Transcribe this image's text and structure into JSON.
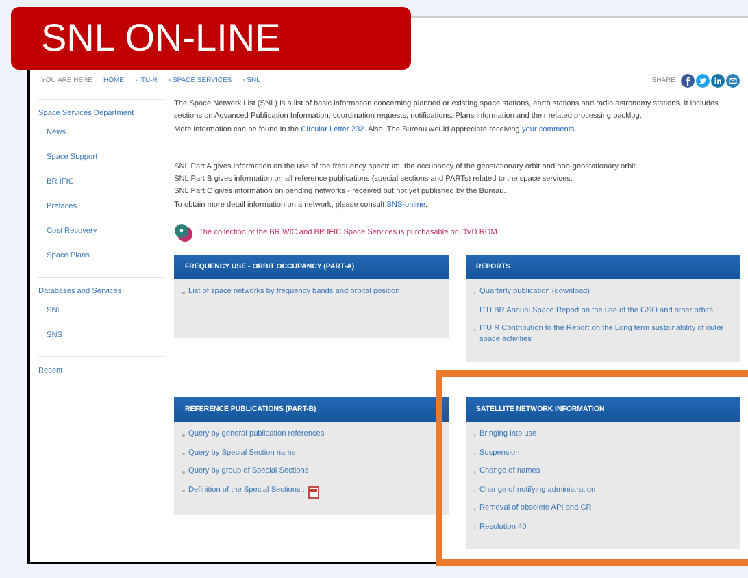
{
  "banner": {
    "title": "SNL ON-LINE"
  },
  "breadcrumb": [
    "YOU ARE HERE",
    "HOME",
    "› ITU-R",
    "› SPACE SERVICES",
    "› SNL"
  ],
  "share": {
    "label": "SHARE"
  },
  "sidebar": {
    "items": [
      {
        "label": "Space Services Department",
        "children": [
          {
            "label": "News"
          },
          {
            "label": "Space Support"
          },
          {
            "label": "BR IFIC"
          },
          {
            "label": "Prefaces"
          },
          {
            "label": "Cost Recovery"
          },
          {
            "label": "Space Plans"
          }
        ]
      },
      {
        "label": "Databases and Services",
        "children": [
          {
            "label": "SNL"
          },
          {
            "label": "SNS"
          }
        ]
      },
      {
        "label": "Recent"
      }
    ]
  },
  "intro": [
    [
      {
        "kind": "text",
        "text": "The Space Network List (SNL) is a list of basic information concerning planned or existing space stations, earth stations and radio astronomy stations. It includes sections on Advanced Publication Information, coordination requests, notifications, Plans information and their related processing backlog."
      }
    ],
    [
      {
        "kind": "text",
        "text": "More information can be found in the "
      },
      {
        "kind": "link",
        "text": "Circular Letter 232"
      },
      {
        "kind": "text",
        "text": ". Also, The Bureau would appreciate receiving "
      },
      {
        "kind": "link",
        "text": "your comments"
      },
      {
        "kind": "text",
        "text": "."
      }
    ]
  ],
  "parts": [
    [
      {
        "kind": "text",
        "text": "SNL Part A gives information on the use of the frequency spectrum, the occupancy of the geostationary orbit and non-geostationary orbit."
      }
    ],
    [
      {
        "kind": "text",
        "text": "SNL Part B gives information on all reference publications (special sections and PARTs) related to the space services."
      }
    ],
    [
      {
        "kind": "text",
        "text": "SNL Part C gives information on pending networks - received but not yet published by the Bureau."
      }
    ],
    [
      {
        "kind": "text",
        "text": "To obtain more detail information on a network, please consult "
      },
      {
        "kind": "link",
        "text": "SNS-online"
      },
      {
        "kind": "text",
        "text": "."
      }
    ]
  ],
  "dvd_notice": "The collection of the BR WIC and BR IFIC Space Services is purchasable on DVD ROM",
  "panels": [
    {
      "title": "FREQUENCY USE - ORBIT OCCUPANCY (PART-A)",
      "highlighted": false,
      "links": [
        {
          "text": "List of space networks by frequency bands and orbital position",
          "pdf": false
        }
      ]
    },
    {
      "title": "REPORTS",
      "highlighted": false,
      "links": [
        {
          "text": "Quarterly publication (download)",
          "pdf": false
        },
        {
          "text": "ITU BR Annual Space Report on the use of the GSO and other orbits",
          "pdf": false
        },
        {
          "text": "ITU R Contribution to the Report on the Long term sustainability of outer space activities",
          "pdf": false
        }
      ]
    },
    {
      "title": "REFERENCE PUBLICATIONS (PART-B)",
      "highlighted": false,
      "links": [
        {
          "text": "Query by general publication references",
          "pdf": false
        },
        {
          "text": "Query by Special Section name",
          "pdf": false
        },
        {
          "text": "Query by group of Special Sections",
          "pdf": false
        },
        {
          "text": "Definition of the Special Sections :",
          "pdf": true
        }
      ]
    },
    {
      "title": "SATELLITE NETWORK INFORMATION",
      "highlighted": true,
      "links": [
        {
          "text": "Bringing into use",
          "pdf": false
        },
        {
          "text": "Suspension",
          "pdf": false
        },
        {
          "text": "Change of names",
          "pdf": false
        },
        {
          "text": "Change of notifying administration",
          "pdf": false
        },
        {
          "text": "Removal of obsolete API and CR",
          "pdf": false
        },
        {
          "text": "Resolution 40",
          "pdf": false
        }
      ]
    }
  ]
}
